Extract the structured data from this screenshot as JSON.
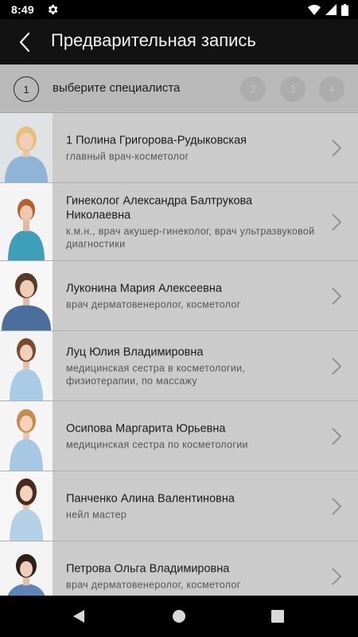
{
  "status_bar": {
    "time": "8:49"
  },
  "header": {
    "title": "Предварительная запись"
  },
  "steps": {
    "active_number": "1",
    "active_label": "выберите специалиста",
    "inactive": [
      "2",
      "3",
      "4"
    ]
  },
  "specialists": [
    {
      "name": "1 Полина Григорова-Рудыковская",
      "title": "главный врач-косметолог"
    },
    {
      "name": "Гинеколог Александра Балтрукова Николаевна",
      "title": "к.м.н., врач акушер-гинеколог, врач ультразвуковой диагностики"
    },
    {
      "name": "Луконина Мария Алексеевна",
      "title": "врач дерматовенеролог, косметолог"
    },
    {
      "name": "Луц Юлия Владимировна",
      "title": "медицинская сестра в косметологии, физиотерапии, по массажу"
    },
    {
      "name": "Осипова Маргарита Юрьевна",
      "title": "медицинская сестра по косметологии"
    },
    {
      "name": "Панченко Алина Валентиновна",
      "title": "нейл мастер"
    },
    {
      "name": "Петрова Ольга Владимировна",
      "title": "врач дерматовенеролог, косметолог"
    }
  ],
  "colors": {
    "app_bar": "#121212",
    "steps_bar": "#b9b9b9",
    "list_background": "#cbcbcb",
    "uniform_blue": "#8fb4d6"
  },
  "icons": {
    "status": [
      "gear-icon",
      "wifi-icon",
      "signal-icon",
      "battery-icon"
    ],
    "header": "back-arrow-icon",
    "row": "chevron-right-icon",
    "nav": [
      "nav-back-icon",
      "nav-home-icon",
      "nav-recents-icon"
    ]
  }
}
